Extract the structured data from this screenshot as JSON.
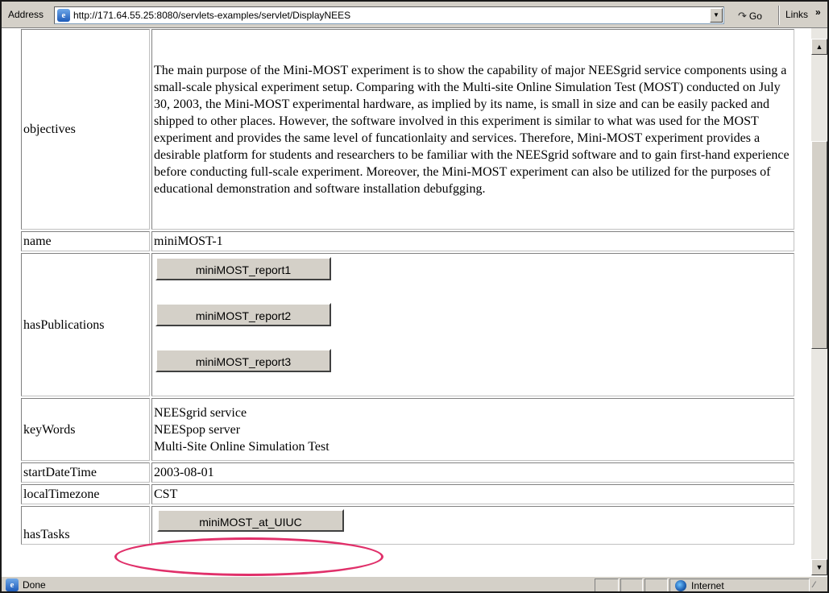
{
  "browser": {
    "address_label": "Address",
    "url": "http://171.64.55.25:8080/servlets-examples/servlet/DisplayNEES",
    "go_label": "Go",
    "links_label": "Links",
    "links_chevron": "»",
    "page_icon": "ie-page-icon",
    "go_icon": "go-arrow-icon"
  },
  "record": {
    "objectives": {
      "key": "objectives",
      "value": "The main purpose of the Mini-MOST experiment is to show the capability of major NEESgrid service components using a small-scale physical experiment setup. Comparing with the Multi-site Online Simulation Test (MOST) conducted on July 30, 2003, the Mini-MOST experimental hardware, as implied by its name, is small in size and can be easily packed and shipped to other places. However, the software involved in this experiment is similar to what was used for the MOST experiment and provides the same level of funcationlaity and services. Therefore, Mini-MOST experiment provides a desirable platform for students and researchers to be familiar with the NEESgrid software and to gain first-hand experience before conducting full-scale experiment. Moreover, the Mini-MOST experiment can also be utilized for the purposes of educational demonstration and software installation debufgging."
    },
    "name": {
      "key": "name",
      "value": "miniMOST-1"
    },
    "hasPublications": {
      "key": "hasPublications",
      "buttons": [
        "miniMOST_report1",
        "miniMOST_report2",
        "miniMOST_report3"
      ]
    },
    "keyWords": {
      "key": "keyWords",
      "values": [
        "NEESgrid service",
        "NEESpop server",
        "Multi-Site Online Simulation Test"
      ]
    },
    "startDateTime": {
      "key": "startDateTime",
      "value": "2003-08-01"
    },
    "localTimezone": {
      "key": "localTimezone",
      "value": "CST"
    },
    "hasTasks": {
      "key": "hasTasks",
      "buttons": [
        "miniMOST_at_UIUC"
      ]
    }
  },
  "status": {
    "text": "Done",
    "zone": "Internet"
  },
  "colors": {
    "highlight": "#e0306a",
    "chrome": "#d4d0c8"
  }
}
